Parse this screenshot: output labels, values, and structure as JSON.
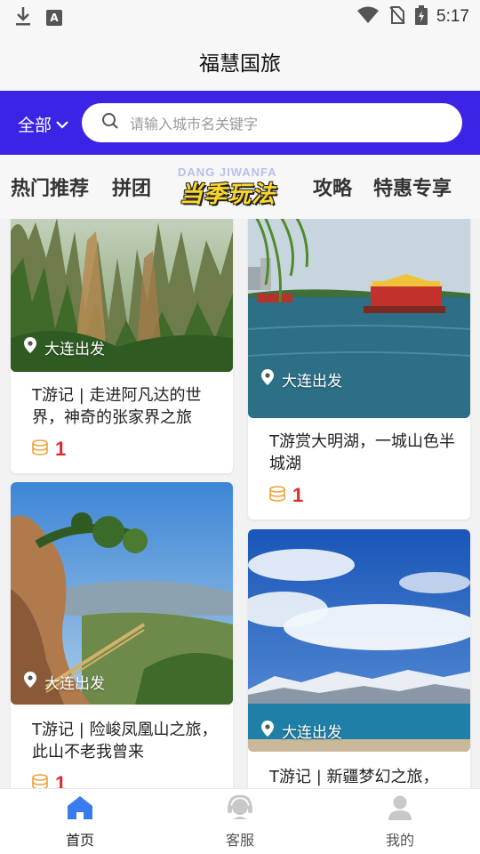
{
  "status_bar": {
    "time": "5:17",
    "left_icons": [
      "download-icon",
      "a-box-icon"
    ],
    "right_icons": [
      "wifi-icon",
      "no-sim-icon",
      "battery-charging-icon"
    ]
  },
  "header": {
    "title": "福慧国旅"
  },
  "search": {
    "region": "全部",
    "placeholder": "请输入城市名关键字"
  },
  "tabs": {
    "items": [
      {
        "label": "热门推荐"
      },
      {
        "label": "拼团"
      },
      {
        "label": "当季玩法",
        "decor_text": "DANG JIWANFA"
      },
      {
        "label": "攻略"
      },
      {
        "label": "特惠专享"
      }
    ]
  },
  "cards": [
    {
      "location": "大连出发",
      "title": "T游记 | 走进阿凡达的世界，神奇的张家界之旅",
      "price": "1",
      "image": "zhangjiajie-mountains"
    },
    {
      "location": "大连出发",
      "title": "T游赏大明湖，一城山色半城湖",
      "price": "1",
      "image": "daming-lake"
    },
    {
      "location": "大连出发",
      "title": "T游记 | 险峻凤凰山之旅，此山不老我曾来",
      "price": "1",
      "image": "fenghuang-mountain"
    },
    {
      "location": "大连出发",
      "title": "T游记 | 新疆梦幻之旅，",
      "price": "",
      "image": "xinjiang-lake"
    }
  ],
  "bottom_nav": {
    "items": [
      {
        "label": "首页",
        "icon": "home-icon",
        "active": true
      },
      {
        "label": "客服",
        "icon": "customer-service-icon",
        "active": false
      },
      {
        "label": "我的",
        "icon": "user-icon",
        "active": false
      }
    ]
  },
  "colors": {
    "brand": "#3b24e3",
    "price": "#e02a2a",
    "nav_active": "#3a7bf0"
  }
}
